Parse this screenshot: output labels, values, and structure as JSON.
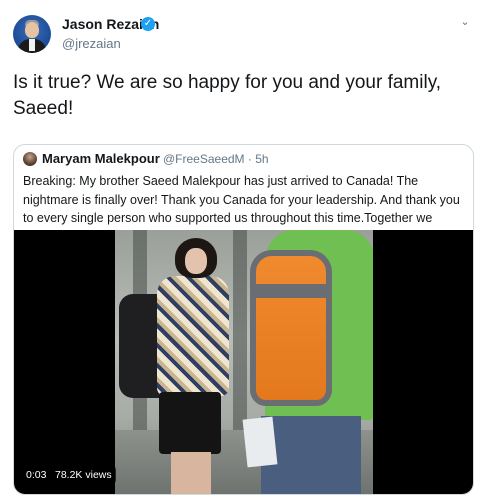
{
  "tweet": {
    "author_name": "Jason Rezaian",
    "verified_symbol": "✓",
    "author_handle": "@jrezaian",
    "caret_symbol": "⌄",
    "text": "Is it true? We are so happy for you and your family, Saeed!"
  },
  "quoted_tweet": {
    "author_name": "Maryam Malekpour",
    "meta": "@FreeSaeedM · 5h",
    "text": "Breaking: My brother Saeed Malekpour has just arrived to Canada! The nightmare is finally over! Thank you Canada for your leadership. And thank you to every single person who supported us throughout this time.Together we prevailed. ✌",
    "video": {
      "duration": "0:03",
      "views": "78.2K views"
    }
  },
  "icons": [
    "verified-badge-icon",
    "chevron-down-icon"
  ],
  "colors": {
    "accent": "#1da1f2",
    "secondary_text": "#657786",
    "border": "#cfd9de"
  }
}
